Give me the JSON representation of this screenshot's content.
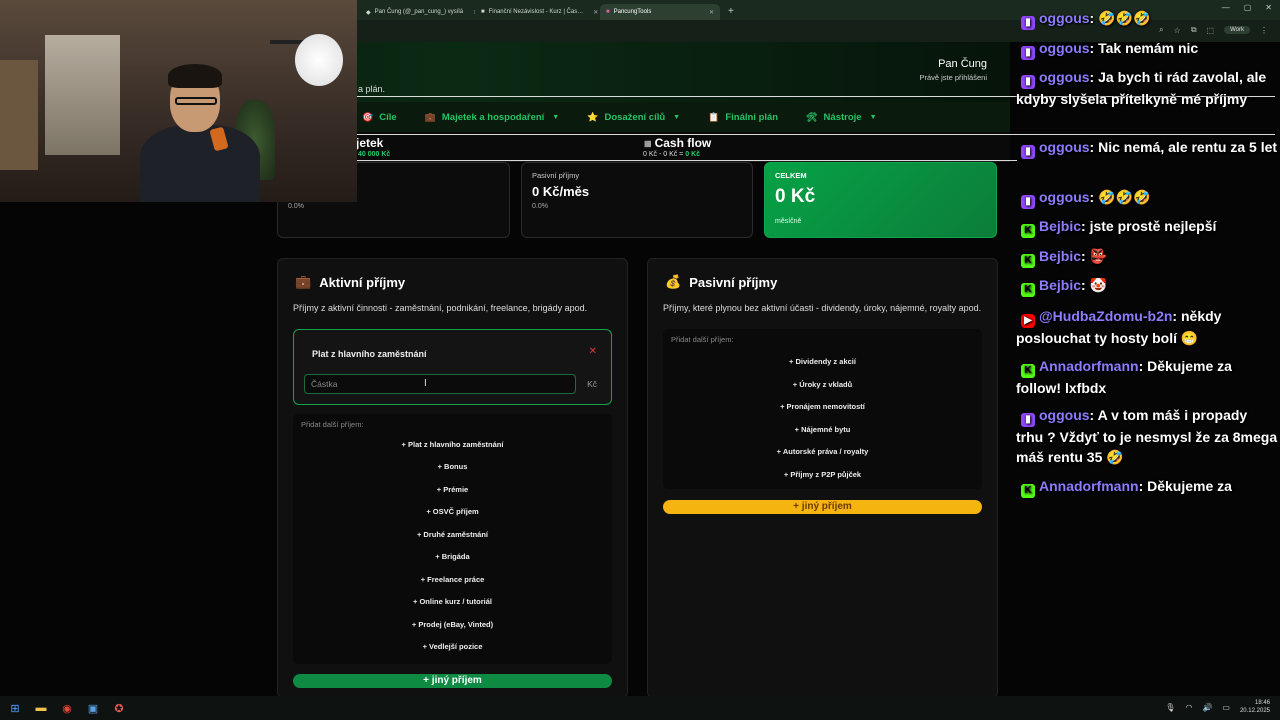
{
  "browser": {
    "tabs": [
      {
        "label": "Pan Čung (@_pan_cung_) vysílá",
        "active": false
      },
      {
        "label": "Finanční Nezávislost - Kurz | Čas…",
        "active": false
      },
      {
        "label": "PancungTools",
        "active": true
      }
    ],
    "new_tab": "+",
    "profile": "Work"
  },
  "header": {
    "subtitle": "a plán.",
    "user_name": "Pan Čung",
    "user_status": "Právě jste přihlášeni"
  },
  "nav": {
    "items": [
      {
        "icon": "🎯",
        "label": "Cíle",
        "caret": false
      },
      {
        "icon": "💼",
        "label": "Majetek a hospodaření",
        "caret": true
      },
      {
        "icon": "⭐",
        "label": "Dosažení cílů",
        "caret": true
      },
      {
        "icon": "📋",
        "label": "Finální plán",
        "caret": false
      },
      {
        "icon": "🛠",
        "label": "Nástroje",
        "caret": true
      }
    ]
  },
  "summary_strip": {
    "majetek_label": "jetek",
    "majetek_value": "40 000 Kč",
    "cashflow_label": "Cash flow",
    "cashflow_values": "0 Kč  -  0 Kč  =",
    "cashflow_result": "0 Kč"
  },
  "stats": {
    "active_pct": "0.0%",
    "passive_title": "Pasivní příjmy",
    "passive_value": "0 Kč/měs",
    "passive_pct": "0.0%",
    "total_title": "CELKEM",
    "total_value": "0 Kč",
    "total_sub": "měsíčně"
  },
  "active_panel": {
    "icon": "💼",
    "title": "Aktivní příjmy",
    "desc": "Příjmy z aktivní činnosti - zaměstnání, podnikání, freelance, brigády apod.",
    "income_name": "Plat z hlavního zaměstnání",
    "amount_placeholder": "Částka",
    "amount_unit": "Kč",
    "add_label": "Přidat další příjem:",
    "add_items": [
      "+ Plat z hlavního zaměstnání",
      "+ Bonus",
      "+ Prémie",
      "+ OSVČ příjem",
      "+ Druhé zaměstnání",
      "+ Brigáda",
      "+ Freelance práce",
      "+ Online kurz / tutoriál",
      "+ Prodej (eBay, Vinted)",
      "+ Vedlejší pozice"
    ],
    "other_button": "+ jiný příjem"
  },
  "passive_panel": {
    "icon": "💰",
    "title": "Pasivní příjmy",
    "desc": "Příjmy, které plynou bez aktivní účasti - dividendy, úroky, nájemné, royalty apod.",
    "add_label": "Přidat další příjem:",
    "add_items": [
      "+ Dividendy z akcií",
      "+ Úroky z vkladů",
      "+ Pronájem nemovitostí",
      "+ Nájemné bytu",
      "+ Autorské práva / royalty",
      "+ Příjmy z P2P půjček"
    ],
    "other_button": "+ jiný příjem"
  },
  "chat": [
    {
      "platform": "twitch",
      "user": "oggous",
      "text": "🤣🤣🤣"
    },
    {
      "platform": "twitch",
      "user": "oggous",
      "text": "Tak nemám nic"
    },
    {
      "platform": "twitch",
      "user": "oggous",
      "text": "Ja bych ti rád zavolal, ale kdyby slyšela přítelkyně mé příjmy"
    },
    {
      "platform": "twitch",
      "user": "oggous",
      "text": "Nic nemá, ale rentu za 5 let"
    },
    {
      "platform": "twitch",
      "user": "oggous",
      "text": "🤣🤣🤣"
    },
    {
      "platform": "kick",
      "user": "Bejbic",
      "text": "jste prostě nejlepší"
    },
    {
      "platform": "kick",
      "user": "Bejbic",
      "text": "👺"
    },
    {
      "platform": "kick",
      "user": "Bejbic",
      "text": "🤡"
    },
    {
      "platform": "youtube",
      "user": "@HudbaZdomu-b2n",
      "text": "někdy poslouchat ty hosty bolí 😁"
    },
    {
      "platform": "kick",
      "user": "Annadorfmann",
      "text": "Děkujeme za follow! lxfbdx"
    },
    {
      "platform": "twitch",
      "user": "oggous",
      "text": "A v tom máš i propady trhu ? Vždyť to je nesmysl že za 8mega máš rentu 35 🤣"
    },
    {
      "platform": "kick",
      "user": "Annadorfmann",
      "text": "Děkujeme za"
    }
  ],
  "taskbar": {
    "time": "18:46",
    "date": "20.12.2025"
  }
}
